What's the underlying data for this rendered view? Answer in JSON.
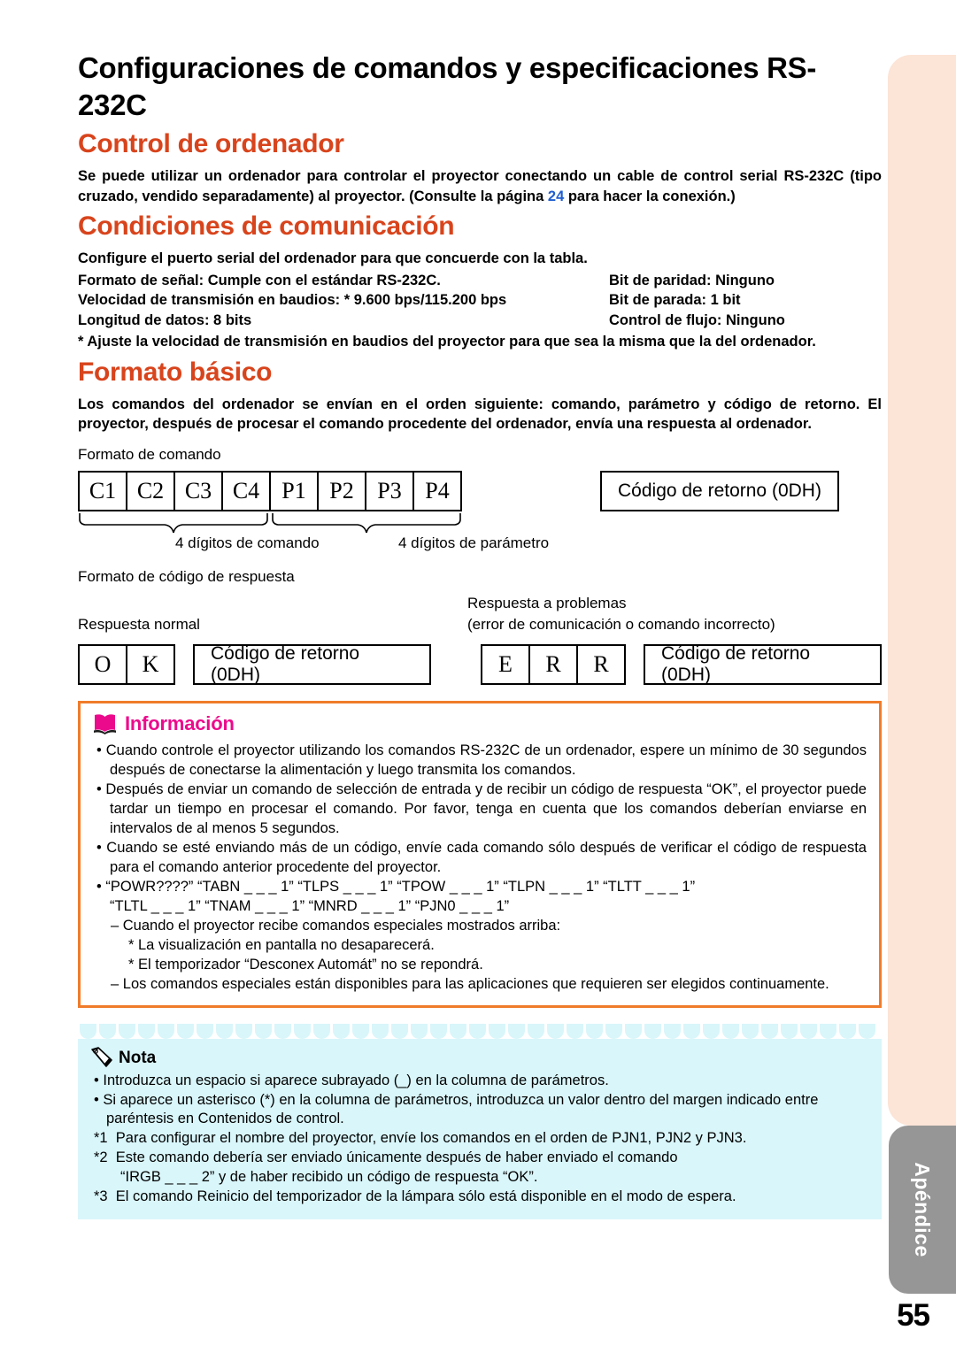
{
  "page": {
    "number": "55",
    "tab_label": "Apéndice"
  },
  "title": "Configuraciones de comandos y especificaciones RS-232C",
  "sections": {
    "computer_control": {
      "heading": "Control de ordenador",
      "paragraph_1": "Se puede utilizar un ordenador para controlar el proyector conectando un cable de control serial RS-232C (tipo cruzado, vendido separadamente) al proyector. (Consulte la página ",
      "page_ref": "24",
      "paragraph_2": " para hacer la conexión.)"
    },
    "comm_conditions": {
      "heading": "Condiciones de comunicación",
      "intro": "Configure el puerto serial del ordenador para que concuerde con la tabla.",
      "rows": [
        {
          "left": "Formato de señal: Cumple con el estándar RS-232C.",
          "right": "Bit de paridad: Ninguno"
        },
        {
          "left": "Velocidad de transmisión en baudios: * 9.600 bps/115.200 bps",
          "right": "Bit de parada: 1 bit"
        },
        {
          "left": "Longitud de datos: 8 bits",
          "right": "Control de flujo: Ninguno"
        }
      ],
      "footnote": "* Ajuste la velocidad de transmisión en baudios del proyector para que sea la misma que la del ordenador."
    },
    "basic_format": {
      "heading": "Formato básico",
      "paragraph": "Los comandos del ordenador se envían en el orden siguiente: comando, parámetro y código de retorno. El proyector, después de procesar el comando procedente del ordenador, envía una respuesta al ordenador."
    }
  },
  "diagram": {
    "command_format_label": "Formato de comando",
    "command_cells": [
      "C1",
      "C2",
      "C3",
      "C4",
      "P1",
      "P2",
      "P3",
      "P4"
    ],
    "return_code_box": "Código de retorno (0DH)",
    "brace_command": "4 dígitos de comando",
    "brace_parameter": "4 dígitos de parámetro",
    "response_format_label": "Formato de código de respuesta",
    "normal_label": "Respuesta normal",
    "problem_label_1": "Respuesta a problemas",
    "problem_label_2": "(error de comunicación o comando incorrecto)",
    "ok_cells": [
      "O",
      "K"
    ],
    "err_cells": [
      "E",
      "R",
      "R"
    ],
    "ok_return_box": "Código de retorno (0DH)",
    "err_return_box": "Código de retorno (0DH)"
  },
  "info_box": {
    "title": "Información",
    "icon": "open-book-icon",
    "border_color": "#f07c2a",
    "title_color": "#ec0a8c",
    "bullets": [
      "Cuando controle el proyector utilizando los comandos RS-232C de un ordenador, espere un mínimo de 30 segundos después de conectarse la alimentación y luego transmita los comandos.",
      "Después de enviar un comando de selección de entrada y de recibir un código de respuesta “OK”, el proyector puede tardar un tiempo en procesar el comando. Por favor, tenga en cuenta que los comandos deberían enviarse en intervalos de al menos 5 segundos.",
      "Cuando se esté enviando más de un código, envíe cada comando sólo después de verificar el código de respuesta para el comando anterior procedente del proyector."
    ],
    "command_list_line_1": "“POWR????” “TABN _ _ _ 1” “TLPS _ _ _ 1” “TPOW _ _ _ 1” “TLPN _ _ _ 1” “TLTT _ _ _ 1”",
    "command_list_line_2": "“TLTL _ _ _ 1” “TNAM _ _ _ 1” “MNRD _ _ _ 1” “PJN0 _ _ _ 1”",
    "dashes": [
      "Cuando el proyector recibe comandos especiales mostrados arriba:",
      "Los comandos especiales están disponibles para las aplicaciones que requieren ser elegidos continuamente."
    ],
    "stars": [
      "* La visualización en pantalla no desaparecerá.",
      "* El temporizador “Desconex Automát” no se repondrá."
    ]
  },
  "note_box": {
    "title": "Nota",
    "icon": "pencil-icon",
    "background_color": "#d9f6fa",
    "bullets": [
      "Introduzca un espacio si aparece subrayado (_) en la columna de parámetros.",
      "Si aparece un asterisco (*) en la columna de parámetros, introduzca un valor dentro del margen indicado entre paréntesis en Contenidos de control."
    ],
    "numbered": [
      {
        "marker": "*1",
        "text": "Para configurar el nombre del proyector, envíe los comandos en el orden de PJN1, PJN2 y PJN3."
      },
      {
        "marker": "*2",
        "text": "Este comando debería ser enviado únicamente después de haber enviado el comando"
      },
      {
        "marker": "*3",
        "text": "El comando Reinicio del temporizador de la lámpara sólo está disponible en el modo de espera."
      }
    ],
    "note2_continuation": "“IRGB _ _ _ 2” y de haber recibido un código de respuesta “OK”."
  }
}
